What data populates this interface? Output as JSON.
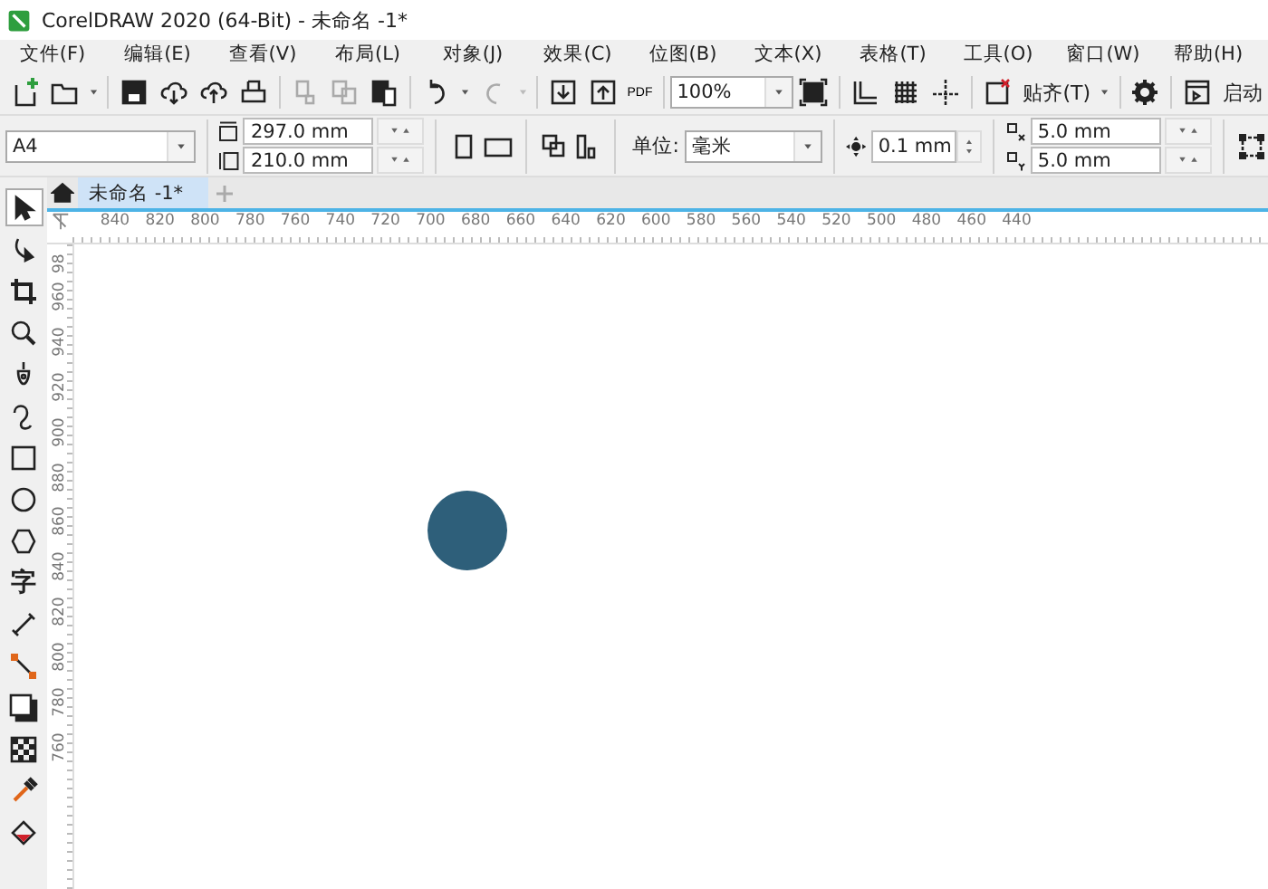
{
  "window": {
    "title": "CorelDRAW 2020 (64-Bit) - 未命名 -1*"
  },
  "menu": [
    "文件(F)",
    "编辑(E)",
    "查看(V)",
    "布局(L)",
    "对象(J)",
    "效果(C)",
    "位图(B)",
    "文本(X)",
    "表格(T)",
    "工具(O)",
    "窗口(W)",
    "帮助(H)"
  ],
  "toolbar": {
    "pdf_label": "PDF",
    "zoom": "100%",
    "snap": "贴齐(T)",
    "launch": "启动"
  },
  "property_bar": {
    "page_size": "A4",
    "width": "297.0 mm",
    "height": "210.0 mm",
    "unit_label": "单位:",
    "unit": "毫米",
    "nudge": "0.1 mm",
    "duplicate_x": "5.0 mm",
    "duplicate_y": "5.0 mm"
  },
  "tabs": [
    {
      "label": "未命名 -1*",
      "selected": true
    }
  ],
  "toolbox": [
    {
      "kind": "pick",
      "selected": true
    },
    {
      "kind": "shape",
      "selected": false
    },
    {
      "kind": "crop",
      "selected": false
    },
    {
      "kind": "zoom",
      "selected": false
    },
    {
      "kind": "pen",
      "selected": false
    },
    {
      "kind": "curve",
      "selected": false
    },
    {
      "kind": "rectangle",
      "selected": false
    },
    {
      "kind": "ellipse",
      "selected": false
    },
    {
      "kind": "polygon",
      "selected": false
    },
    {
      "kind": "text",
      "label": "字",
      "selected": false
    },
    {
      "kind": "line",
      "selected": false
    },
    {
      "kind": "connector",
      "selected": false
    },
    {
      "kind": "shadow",
      "selected": false
    },
    {
      "kind": "transparency",
      "selected": false
    },
    {
      "kind": "eyedropper",
      "selected": false
    },
    {
      "kind": "fill",
      "selected": false
    }
  ],
  "horizontal_ruler": [
    "840",
    "820",
    "800",
    "780",
    "760",
    "740",
    "720",
    "700",
    "680",
    "660",
    "640",
    "620",
    "600",
    "580",
    "560",
    "540",
    "520",
    "500",
    "480",
    "460",
    "440"
  ],
  "vertical_ruler": [
    "98",
    "960",
    "940",
    "920",
    "900",
    "880",
    "860",
    "840",
    "820",
    "800",
    "780",
    "760"
  ],
  "canvas": {
    "shapes": [
      {
        "kind": "circle",
        "color": "#2e5f7a"
      }
    ]
  }
}
